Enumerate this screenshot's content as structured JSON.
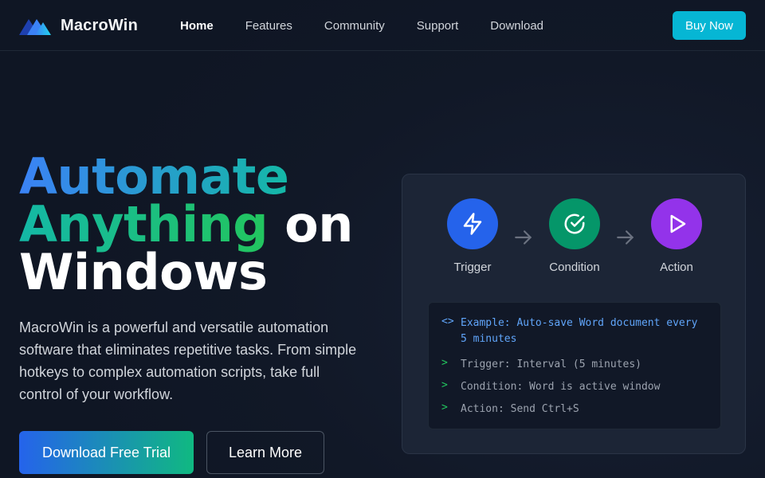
{
  "brand": {
    "name": "MacroWin",
    "logo": "macrowin-m-logo"
  },
  "nav": {
    "links": [
      "Home",
      "Features",
      "Community",
      "Support",
      "Download"
    ],
    "active": "Home",
    "buy_label": "Buy Now"
  },
  "hero": {
    "title_word1": "Automate",
    "title_word2": "Anything",
    "title_word3": " on",
    "title_word4": "Windows",
    "description": "MacroWin is a powerful and versatile automation software that eliminates repetitive tasks. From simple hotkeys to complex automation scripts, take full control of your workflow.",
    "primary_cta": "Download Free Trial",
    "secondary_cta": "Learn More"
  },
  "flow": {
    "steps": [
      {
        "label": "Trigger",
        "icon": "lightning-icon",
        "color": "#2563eb"
      },
      {
        "label": "Condition",
        "icon": "check-circle-icon",
        "color": "#059669"
      },
      {
        "label": "Action",
        "icon": "play-icon",
        "color": "#9333ea"
      }
    ],
    "example": {
      "title": "Example: Auto-save Word document every 5 minutes",
      "lines": [
        "Trigger: Interval (5 minutes)",
        "Condition: Word is active window",
        "Action: Send Ctrl+S"
      ]
    }
  },
  "colors": {
    "accent": "#06b6d4",
    "background": "#111827",
    "card": "#1c2536"
  }
}
